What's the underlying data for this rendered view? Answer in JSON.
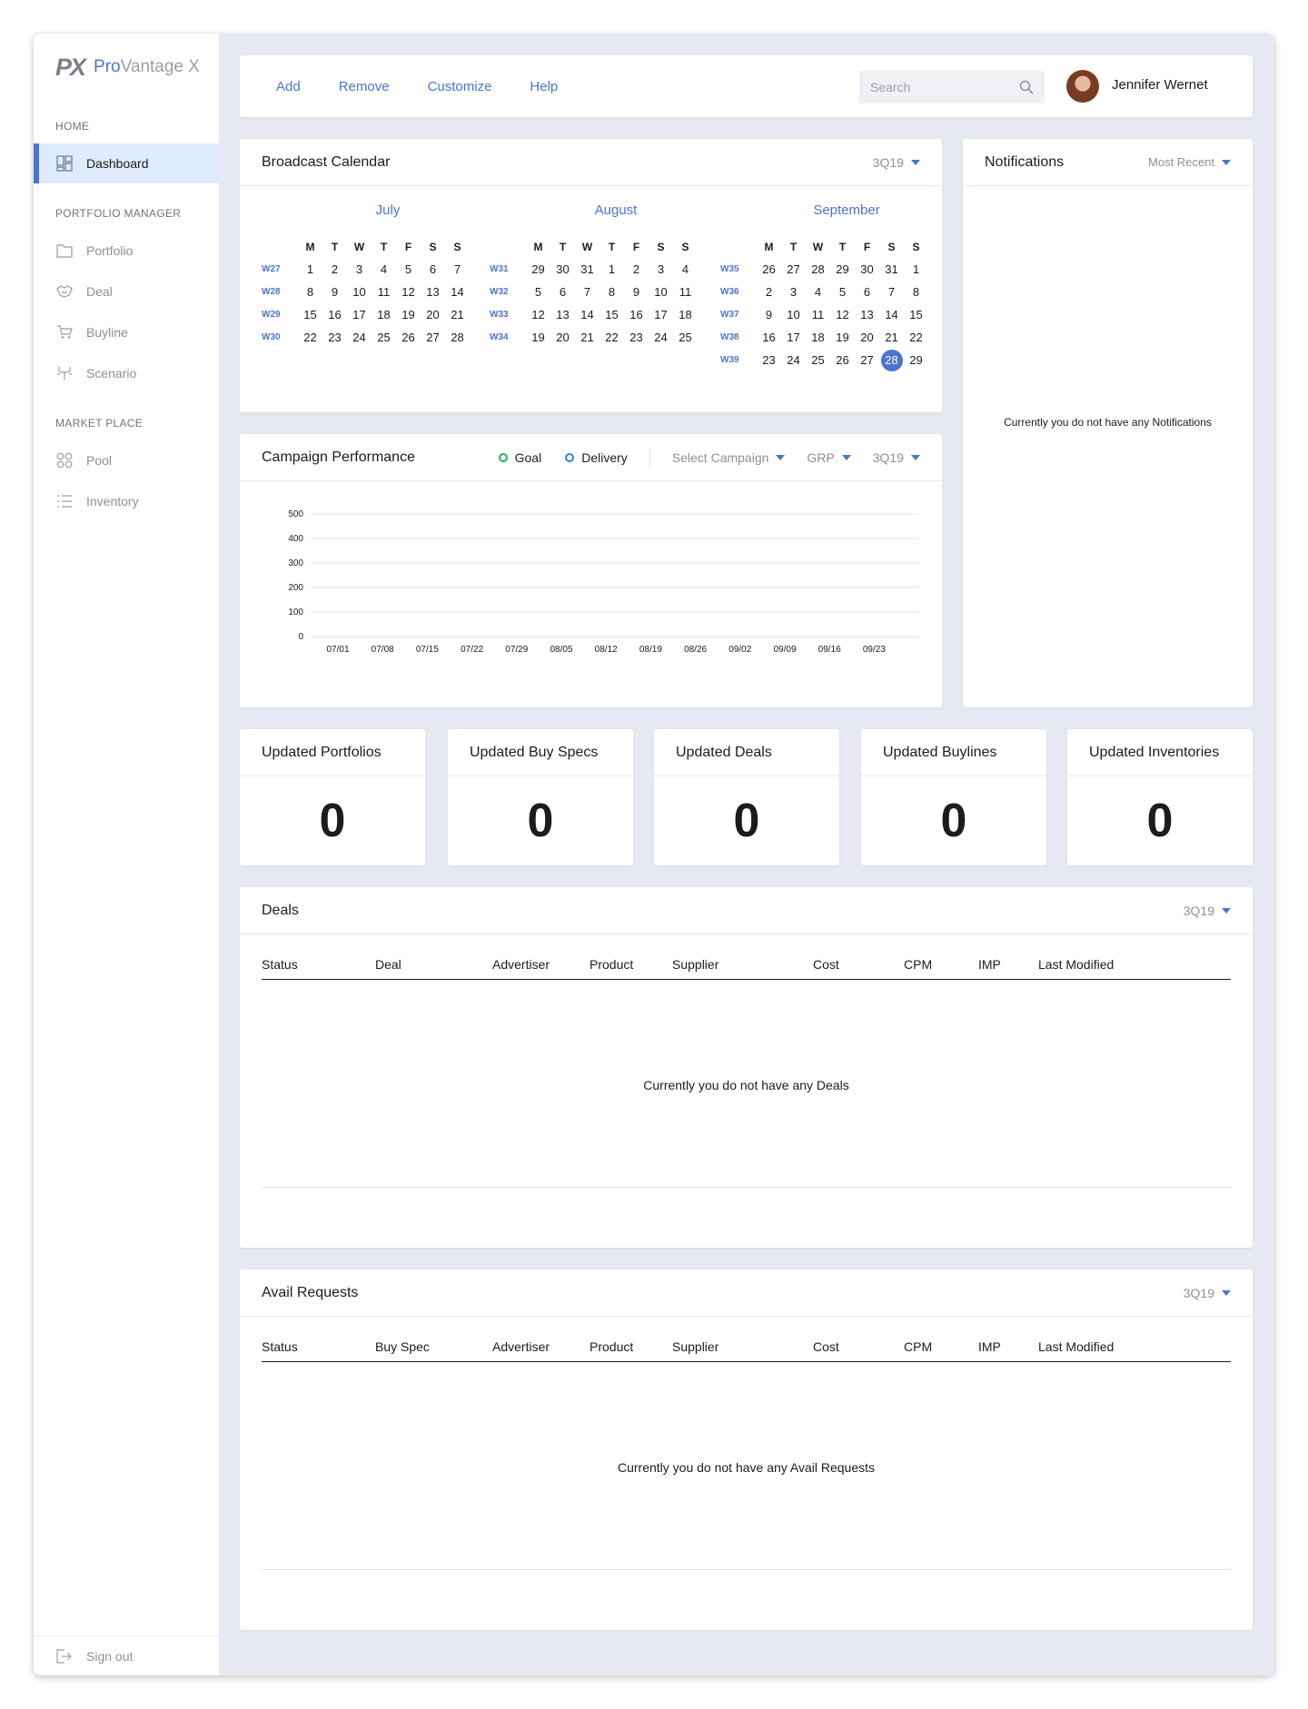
{
  "app": {
    "logo_mark": "PX",
    "logo_pro": "Pro",
    "logo_rest": "Vantage X"
  },
  "sidebar": {
    "home_label": "HOME",
    "portfolio_manager_label": "PORTFOLIO MANAGER",
    "market_place_label": "MARKET PLACE",
    "dashboard": "Dashboard",
    "portfolio": "Portfolio",
    "deal": "Deal",
    "buyline": "Buyline",
    "scenario": "Scenario",
    "pool": "Pool",
    "inventory": "Inventory",
    "sign_out": "Sign out"
  },
  "topbar": {
    "add": "Add",
    "remove": "Remove",
    "customize": "Customize",
    "help": "Help",
    "search_placeholder": "Search",
    "user_name": "Jennifer Wernet"
  },
  "calendar": {
    "title": "Broadcast Calendar",
    "quarter": "3Q19",
    "day_names": [
      "M",
      "T",
      "W",
      "T",
      "F",
      "S",
      "S"
    ],
    "months": [
      {
        "name": "July",
        "weeks": [
          {
            "label": "W27",
            "days": [
              "1",
              "2",
              "3",
              "4",
              "5",
              "6",
              "7"
            ]
          },
          {
            "label": "W28",
            "days": [
              "8",
              "9",
              "10",
              "11",
              "12",
              "13",
              "14"
            ]
          },
          {
            "label": "W29",
            "days": [
              "15",
              "16",
              "17",
              "18",
              "19",
              "20",
              "21"
            ]
          },
          {
            "label": "W30",
            "days": [
              "22",
              "23",
              "24",
              "25",
              "26",
              "27",
              "28"
            ]
          }
        ]
      },
      {
        "name": "August",
        "weeks": [
          {
            "label": "W31",
            "days": [
              "29",
              "30",
              "31",
              "1",
              "2",
              "3",
              "4"
            ]
          },
          {
            "label": "W32",
            "days": [
              "5",
              "6",
              "7",
              "8",
              "9",
              "10",
              "11"
            ]
          },
          {
            "label": "W33",
            "days": [
              "12",
              "13",
              "14",
              "15",
              "16",
              "17",
              "18"
            ]
          },
          {
            "label": "W34",
            "days": [
              "19",
              "20",
              "21",
              "22",
              "23",
              "24",
              "25"
            ]
          }
        ]
      },
      {
        "name": "September",
        "weeks": [
          {
            "label": "W35",
            "days": [
              "26",
              "27",
              "28",
              "29",
              "30",
              "31",
              "1"
            ]
          },
          {
            "label": "W36",
            "days": [
              "2",
              "3",
              "4",
              "5",
              "6",
              "7",
              "8"
            ]
          },
          {
            "label": "W37",
            "days": [
              "9",
              "10",
              "11",
              "12",
              "13",
              "14",
              "15"
            ]
          },
          {
            "label": "W38",
            "days": [
              "16",
              "17",
              "18",
              "19",
              "20",
              "21",
              "22"
            ]
          },
          {
            "label": "W39",
            "days": [
              "23",
              "24",
              "25",
              "26",
              "27",
              "28",
              "29"
            ]
          }
        ]
      }
    ],
    "today": "28"
  },
  "campaign": {
    "title": "Campaign Performance",
    "legend_goal": "Goal",
    "legend_delivery": "Delivery",
    "select_campaign": "Select Campaign",
    "metric": "GRP",
    "quarter": "3Q19",
    "goal_color": "#27ae60",
    "delivery_color": "#2f80ed"
  },
  "chart_data": {
    "type": "line",
    "x": [
      "07/01",
      "07/08",
      "07/15",
      "07/22",
      "07/29",
      "08/05",
      "08/12",
      "08/19",
      "08/26",
      "09/02",
      "09/09",
      "09/16",
      "09/23"
    ],
    "yticks": [
      0,
      100,
      200,
      300,
      400,
      500
    ],
    "ylim": [
      0,
      500
    ],
    "grid": true,
    "series": [
      {
        "name": "Goal",
        "values": []
      },
      {
        "name": "Delivery",
        "values": []
      }
    ]
  },
  "notifications": {
    "title": "Notifications",
    "sort": "Most Recent",
    "empty": "Currently you do not have any Notifications"
  },
  "stats": [
    {
      "title": "Updated Portfolios",
      "value": "0"
    },
    {
      "title": "Updated Buy Specs",
      "value": "0"
    },
    {
      "title": "Updated Deals",
      "value": "0"
    },
    {
      "title": "Updated Buylines",
      "value": "0"
    },
    {
      "title": "Updated Inventories",
      "value": "0"
    }
  ],
  "deals": {
    "title": "Deals",
    "quarter": "3Q19",
    "columns": [
      "Status",
      "Deal",
      "Advertiser",
      "Product",
      "Supplier",
      "Cost",
      "CPM",
      "IMP",
      "Last Modified"
    ],
    "empty": "Currently you do not have any Deals"
  },
  "avails": {
    "title": "Avail Requests",
    "quarter": "3Q19",
    "columns": [
      "Status",
      "Buy Spec",
      "Advertiser",
      "Product",
      "Supplier",
      "Cost",
      "CPM",
      "IMP",
      "Last Modified"
    ],
    "empty": "Currently you do not have any Avail Requests"
  }
}
